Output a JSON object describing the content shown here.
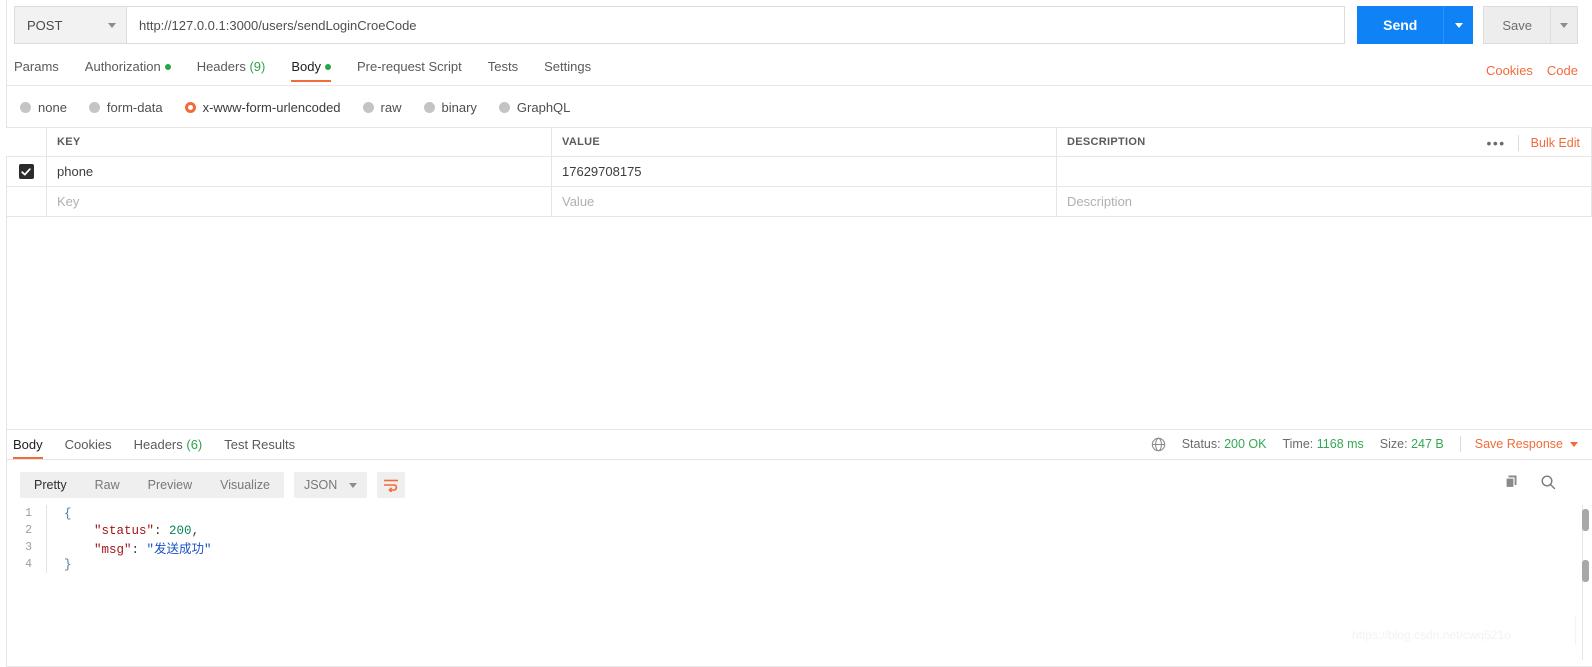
{
  "request": {
    "method": "POST",
    "url": "http://127.0.0.1:3000/users/sendLoginCroeCode",
    "send_label": "Send",
    "save_label": "Save",
    "tabs": [
      {
        "label": "Params",
        "badge": "",
        "badge_type": "none"
      },
      {
        "label": "Authorization",
        "badge": "",
        "badge_type": "dot"
      },
      {
        "label": "Headers",
        "badge": "(9)",
        "badge_type": "count"
      },
      {
        "label": "Body",
        "badge": "",
        "badge_type": "dot"
      },
      {
        "label": "Pre-request Script",
        "badge": "",
        "badge_type": "none"
      },
      {
        "label": "Tests",
        "badge": "",
        "badge_type": "none"
      },
      {
        "label": "Settings",
        "badge": "",
        "badge_type": "none"
      }
    ],
    "active_tab": "Body",
    "links": {
      "cookies": "Cookies",
      "code": "Code"
    },
    "body_types": [
      {
        "label": "none",
        "selected": false
      },
      {
        "label": "form-data",
        "selected": false
      },
      {
        "label": "x-www-form-urlencoded",
        "selected": true
      },
      {
        "label": "raw",
        "selected": false
      },
      {
        "label": "binary",
        "selected": false
      },
      {
        "label": "GraphQL",
        "selected": false
      }
    ]
  },
  "kv_table": {
    "headers": {
      "key": "KEY",
      "value": "VALUE",
      "description": "DESCRIPTION"
    },
    "tools": {
      "more": "•••",
      "bulk_edit": "Bulk Edit"
    },
    "rows": [
      {
        "checked": true,
        "key": "phone",
        "value": "17629708175",
        "description": ""
      }
    ],
    "placeholders": {
      "key": "Key",
      "value": "Value",
      "description": "Description"
    }
  },
  "response": {
    "tabs": [
      {
        "label": "Body",
        "badge": ""
      },
      {
        "label": "Cookies",
        "badge": ""
      },
      {
        "label": "Headers",
        "badge": "(6)"
      },
      {
        "label": "Test Results",
        "badge": ""
      }
    ],
    "active_tab": "Body",
    "meta": {
      "status_label": "Status:",
      "status_value": "200 OK",
      "time_label": "Time:",
      "time_value": "1168 ms",
      "size_label": "Size:",
      "size_value": "247 B",
      "save_response": "Save Response"
    },
    "view_tabs": [
      {
        "label": "Pretty",
        "active": true
      },
      {
        "label": "Raw",
        "active": false
      },
      {
        "label": "Preview",
        "active": false
      },
      {
        "label": "Visualize",
        "active": false
      }
    ],
    "format": "JSON",
    "body_lines": [
      {
        "n": "1",
        "parts": [
          {
            "t": "{",
            "c": "jbrace"
          }
        ]
      },
      {
        "n": "2",
        "parts": [
          {
            "t": "    ",
            "c": "jpunc"
          },
          {
            "t": "\"status\"",
            "c": "jkey"
          },
          {
            "t": ": ",
            "c": "jpunc"
          },
          {
            "t": "200",
            "c": "jnum"
          },
          {
            "t": ",",
            "c": "jpunc"
          }
        ]
      },
      {
        "n": "3",
        "parts": [
          {
            "t": "    ",
            "c": "jpunc"
          },
          {
            "t": "\"msg\"",
            "c": "jkey"
          },
          {
            "t": ": ",
            "c": "jpunc"
          },
          {
            "t": "\"发送成功\"",
            "c": "jstr"
          }
        ]
      },
      {
        "n": "4",
        "parts": [
          {
            "t": "}",
            "c": "jbrace"
          }
        ]
      }
    ]
  },
  "watermark": "https://blog.csdn.net/cwq521o",
  "colors": {
    "accent_orange": "#f26b3a",
    "send_blue": "#0f83f5",
    "status_green": "#35a855",
    "dot_green": "#28a745"
  }
}
